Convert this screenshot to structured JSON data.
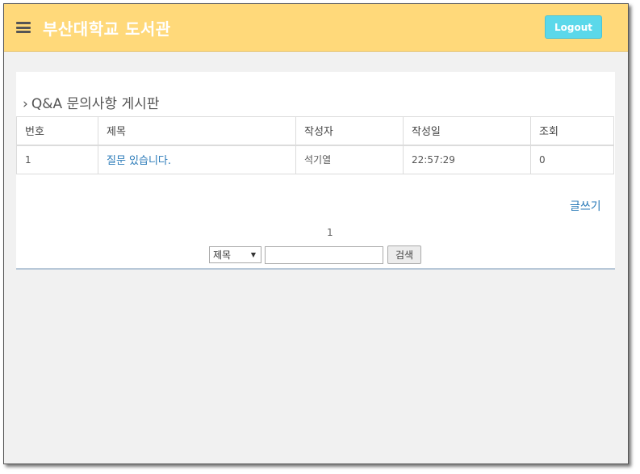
{
  "header": {
    "title": "부산대학교 도서관",
    "menu_icon": "hamburger-icon",
    "logout_label": "Logout",
    "colors": {
      "bar": "#ffd97a",
      "logout": "#5bd8ea"
    }
  },
  "board": {
    "title": "Q&A 문의사항 게시판",
    "title_icon": "chevron-right-icon",
    "columns": [
      "번호",
      "제목",
      "작성자",
      "작성일",
      "조회"
    ],
    "rows": [
      {
        "no": "1",
        "title": "질문 있습니다.",
        "author": "석기열",
        "date": "22:57:29",
        "views": "0"
      }
    ],
    "write_label": "글쓰기",
    "pagination": {
      "current": "1"
    },
    "search": {
      "field_selected": "제목",
      "query": "",
      "button_label": "검색"
    }
  }
}
